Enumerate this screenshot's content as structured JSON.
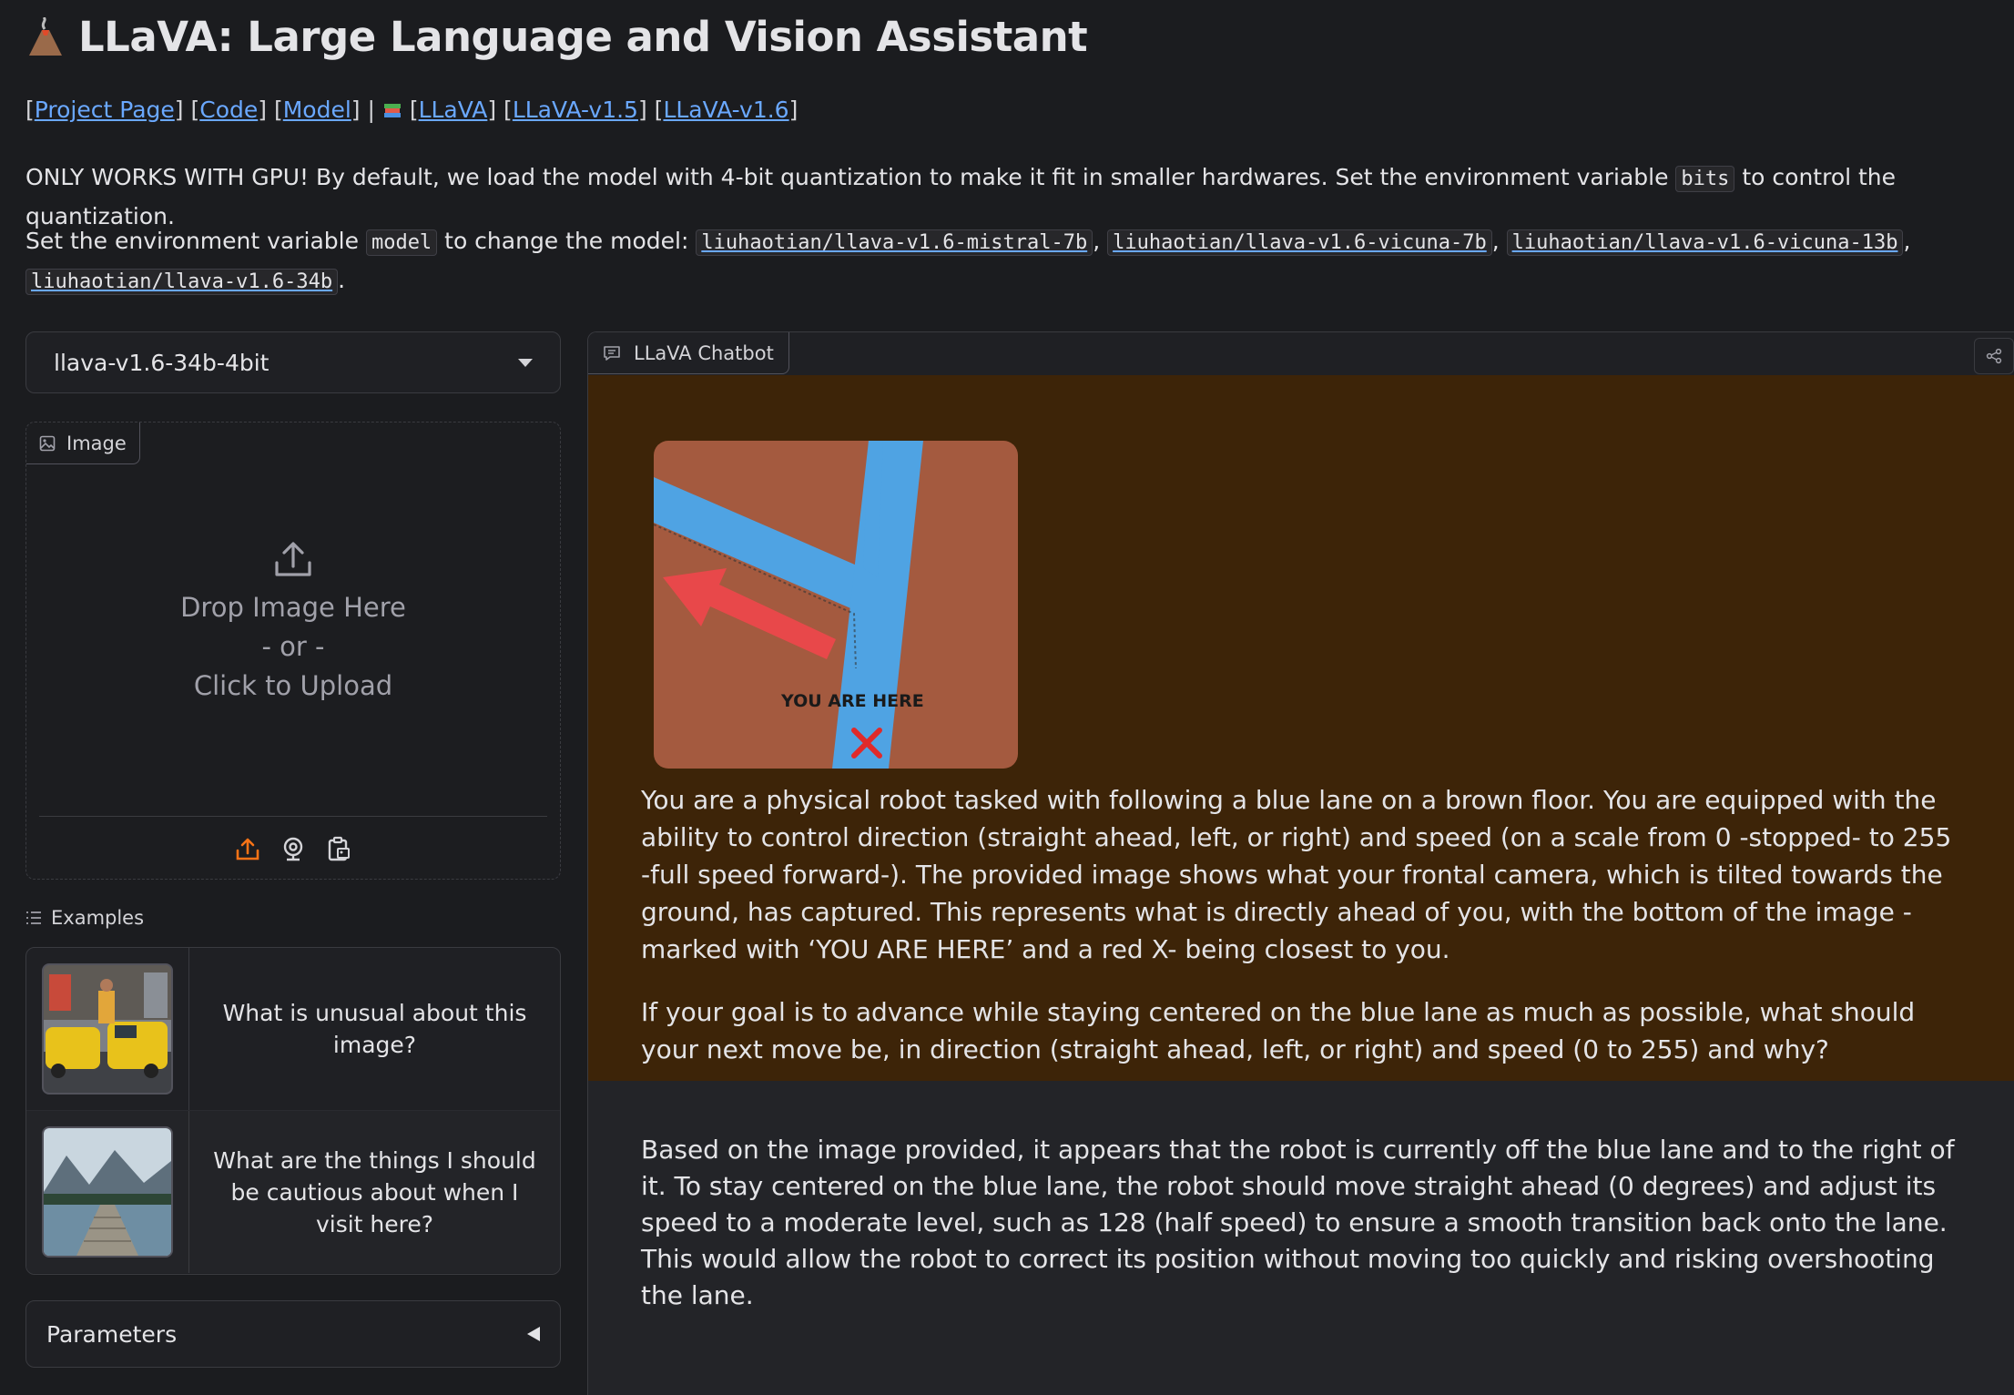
{
  "header": {
    "title": "LLaVA: Large Language and Vision Assistant",
    "links": {
      "project_page": "Project Page",
      "code": "Code",
      "model": "Model",
      "llava": "LLaVA",
      "llava_v15": "LLaVA-v1.5",
      "llava_v16": "LLaVA-v1.6"
    },
    "gpu_note_pre": "ONLY WORKS WITH GPU! By default, we load the model with 4-bit quantization to make it fit in smaller hardwares. Set the environment variable",
    "gpu_note_var": "bits",
    "gpu_note_post": "to control the quantization.",
    "model_note_pre": "Set the environment variable",
    "model_note_var": "model",
    "model_note_post": "to change the model:",
    "models": [
      "liuhaotian/llava-v1.6-mistral-7b",
      "liuhaotian/llava-v1.6-vicuna-7b",
      "liuhaotian/llava-v1.6-vicuna-13b",
      "liuhaotian/llava-v1.6-34b"
    ]
  },
  "left": {
    "model_select": "llava-v1.6-34b-4bit",
    "image_tab": "Image",
    "upload": {
      "line1": "Drop Image Here",
      "line2": "- or -",
      "line3": "Click to Upload"
    },
    "examples_label": "Examples",
    "examples": [
      {
        "text": "What is unusual about this image?"
      },
      {
        "text": "What are the things I should be cautious about when I visit here?"
      }
    ],
    "parameters_label": "Parameters"
  },
  "chat": {
    "tab_label": "LLaVA Chatbot",
    "user_image_caption": "YOU ARE HERE",
    "user_paragraph1": "You are a physical robot tasked with following a blue lane on a brown floor. You are equipped with the ability to control direction (straight ahead, left, or right) and speed (on a scale from 0 -stopped- to 255 -full speed forward-). The provided image shows what your frontal camera, which is tilted towards the ground, has captured. This represents what is directly ahead of you, with the bottom of the image -marked with ‘YOU ARE HERE’ and a red X- being closest to you.",
    "user_paragraph2": "If your goal is to advance while staying centered on the blue lane as much as possible, what should your next move be, in direction (straight ahead, left, or right) and speed (0 to 255) and why?",
    "bot_reply": "Based on the image provided, it appears that the robot is currently off the blue lane and to the right of it. To stay centered on the blue lane, the robot should move straight ahead (0 degrees) and adjust its speed to a moderate level, such as 128 (half speed) to ensure a smooth transition back onto the lane. This would allow the robot to correct its position without moving too quickly and risking overshooting the lane."
  },
  "colors": {
    "background": "#1b1c1f",
    "user_bubble": "#3d2408",
    "bot_bubble": "#232428",
    "link": "#6aa8ff",
    "accent_orange": "#f97316",
    "lane_blue": "#4fa3e3",
    "floor_brown": "#a45a3f",
    "arrow_red": "#e8484a"
  },
  "icons": [
    "volcano-icon",
    "books-icon",
    "caret-down-icon",
    "image-icon",
    "upload-icon",
    "webcam-icon",
    "clipboard-icon",
    "list-icon",
    "chat-icon",
    "share-icon",
    "triangle-left-icon"
  ]
}
